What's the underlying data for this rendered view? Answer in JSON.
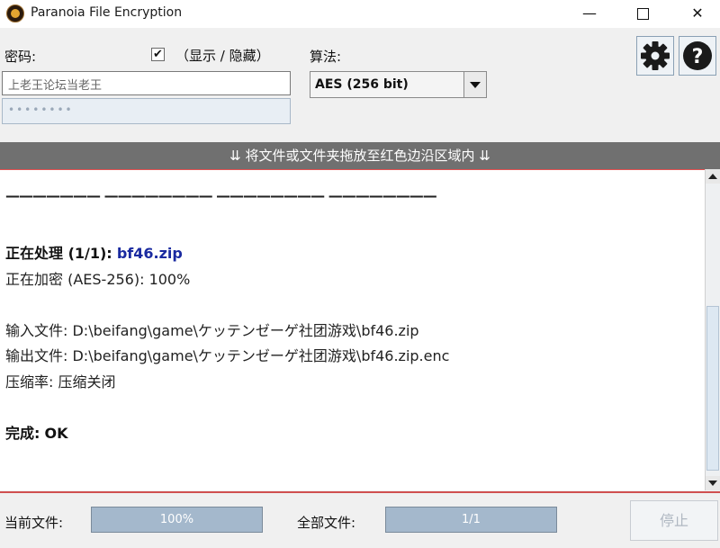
{
  "window": {
    "title": "Paranoia File Encryption",
    "minimize": "—",
    "close": "✕"
  },
  "password": {
    "label": "密码:",
    "value": "上老王论坛当老王",
    "confirm_mask": "••••••••",
    "show_toggle_checked": true,
    "show_toggle_mark": "✔",
    "show_toggle_label": "（显示 / 隐藏）"
  },
  "algorithm": {
    "label": "算法:",
    "selected": "AES (256 bit)"
  },
  "toolbar": {
    "settings_icon": "gear-icon",
    "help_icon": "help-icon",
    "help_glyph": "?"
  },
  "drop_zone": {
    "text": "⇊ 将文件或文件夹拖放至红色边沿区域内 ⇊"
  },
  "log": {
    "separator": "——————— ———————— ———————— ————————",
    "processing_label": "正在处理 (1/1):",
    "processing_file": "bf46.zip",
    "encrypting": "正在加密 (AES-256): 100%",
    "input_file": "输入文件: D:\\beifang\\game\\ケッテンゼーゲ社团游戏\\bf46.zip",
    "output_file": "输出文件: D:\\beifang\\game\\ケッテンゼーゲ社团游戏\\bf46.zip.enc",
    "compression": "压缩率: 压缩关闭",
    "done_label": "完成:",
    "done_value": "OK"
  },
  "status": {
    "current_file_label": "当前文件:",
    "current_progress": 1.0,
    "current_progress_text": "100%",
    "all_files_label": "全部文件:",
    "all_progress": 1.0,
    "all_progress_text": "1/1",
    "stop_label": "停止"
  },
  "colors": {
    "accent_red": "#d05050",
    "banner_gray": "#707070",
    "filename_blue": "#1a2aa0",
    "progress_fill": "#a4b8cc"
  }
}
